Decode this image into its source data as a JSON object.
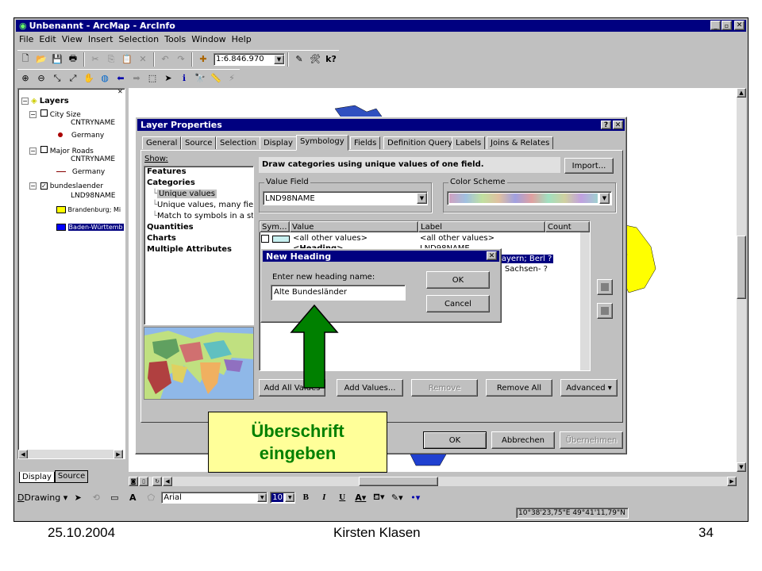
{
  "app": {
    "title": "Unbenannt - ArcMap - ArcInfo",
    "menu": [
      "File",
      "Edit",
      "View",
      "Insert",
      "Selection",
      "Tools",
      "Window",
      "Help"
    ],
    "scale": "1:6.846.970"
  },
  "toc": {
    "root": "Layers",
    "layers": [
      {
        "name": "City Size",
        "field": "CNTRYNAME",
        "item": "Germany"
      },
      {
        "name": "Major Roads",
        "field": "CNTRYNAME",
        "item": "Germany"
      },
      {
        "name": "bundeslaender",
        "field": "LND98NAME",
        "items": [
          "Brandenburg; Mi",
          "Baden-Württemb"
        ]
      }
    ],
    "tabs": [
      "Display",
      "Source"
    ]
  },
  "dialog": {
    "title": "Layer Properties",
    "tabs": [
      "General",
      "Source",
      "Selection",
      "Display",
      "Symbology",
      "Fields",
      "Definition Query",
      "Labels",
      "Joins & Relates"
    ],
    "show_label": "Show:",
    "tree": [
      "Features",
      "Categories",
      "Unique values",
      "Unique values, many fiel",
      "Match to symbols in a sty",
      "Quantities",
      "Charts",
      "Multiple Attributes"
    ],
    "heading": "Draw categories using unique values of one field.",
    "import_btn": "Import...",
    "value_field_label": "Value Field",
    "value_field": "LND98NAME",
    "color_scheme_label": "Color Scheme",
    "table_headers": [
      "Sym...",
      "Value",
      "Label",
      "Count"
    ],
    "rows": [
      {
        "value": "<all other values>",
        "label": "<all other values>"
      },
      {
        "value": "<Heading>",
        "label": "LND98NAME"
      },
      {
        "value": "",
        "label": "Bayern; Berl ?"
      },
      {
        "value": "",
        "label": "n; Sachsen- ?"
      }
    ],
    "buttons": [
      "Add All Values",
      "Add Values...",
      "Remove",
      "Remove All",
      "Advanced"
    ],
    "ok": "OK",
    "cancel": "Abbrechen",
    "apply": "Übernehmen"
  },
  "subdialog": {
    "title": "New Heading",
    "prompt": "Enter new heading name:",
    "value": "Alte Bundesländer",
    "ok": "OK",
    "cancel": "Cancel"
  },
  "callout": {
    "line1": "Überschrift",
    "line2": "eingeben"
  },
  "drawing_toolbar": {
    "label": "Drawing",
    "font": "Arial",
    "size": "10",
    "bold": "B",
    "italic": "I",
    "underline": "U"
  },
  "status": {
    "coords": "10°38'23,75\"E 49°41'11,79\"N"
  },
  "footer": {
    "date": "25.10.2004",
    "author": "Kirsten Klasen",
    "page": "34"
  },
  "colors": {
    "titlebar": "#000080",
    "callout_bg": "#ffff99",
    "arrow": "#008000",
    "state_yellow": "#ffff00",
    "state_blue": "#0000ff"
  }
}
